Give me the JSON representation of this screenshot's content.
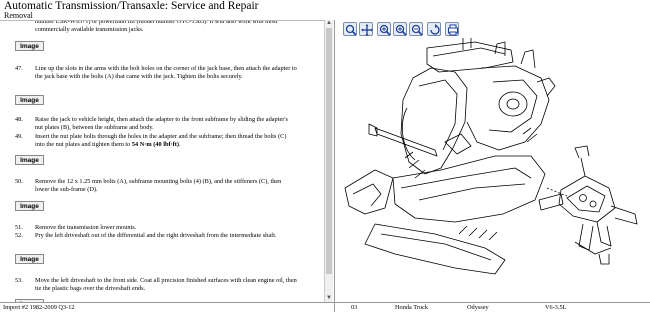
{
  "header": {
    "title": "Automatic Transmission/Transaxle:  Service and Repair",
    "subtitle": "Removal"
  },
  "steps": [
    {
      "num": "",
      "text": "number LSK-W9571) or powertrain lift (model number OTC-1585). It will also work with most commercially available transmission jacks."
    },
    {
      "num": "47.",
      "text": "Line up the slots in the arms with the bolt holes on the corner of the jack base, then attach the adapter to the jack base with the bolts (A) that came with the jack. Tighten the bolts securely."
    },
    {
      "num": "48.",
      "text": "Raise the jack to vehicle height, then attach the adapter to the front subframe by sliding the adapter's nut plates (B), between the subframe and body."
    },
    {
      "num": "49.",
      "text": "Insert the nut plate bolts through the holes in the adapter and the subframe; then thread the bolts (C) into the nut plates and tighten them to ",
      "bold": "54 N·m (40 lbf·ft)",
      "after": "."
    },
    {
      "num": "50.",
      "text": "Remove the 12 x 1.25 mm bolts (A), subframe mounting bolts (4) (B), and the stiffeners (C), then lower the sub-frame (D)."
    },
    {
      "num": "51.",
      "text": "Remove the transmission lower mounts."
    },
    {
      "num": "52.",
      "text": "Pry the left driveshaft out of the differential and the right driveshaft from the intermediate shaft."
    },
    {
      "num": "53.",
      "text": "Move the left driveshaft to the front side. Coat all precision finished surfaces with clean engine oil, then tie the plastic bags over the driveshaft ends."
    }
  ],
  "image_button_label": "Image",
  "toolbar": {
    "tools": [
      "zoom-fit-icon",
      "pan-icon",
      "zoom-in-icon",
      "zoom-in-2-icon",
      "zoom-out-icon",
      "rotate-icon",
      "print-icon"
    ]
  },
  "statusbar": {
    "source": "Import #2 1982-2009 Q3-12",
    "code": "03",
    "make": "Honda Truck",
    "model": "Odyssey",
    "engine": "V6-3.5L"
  }
}
